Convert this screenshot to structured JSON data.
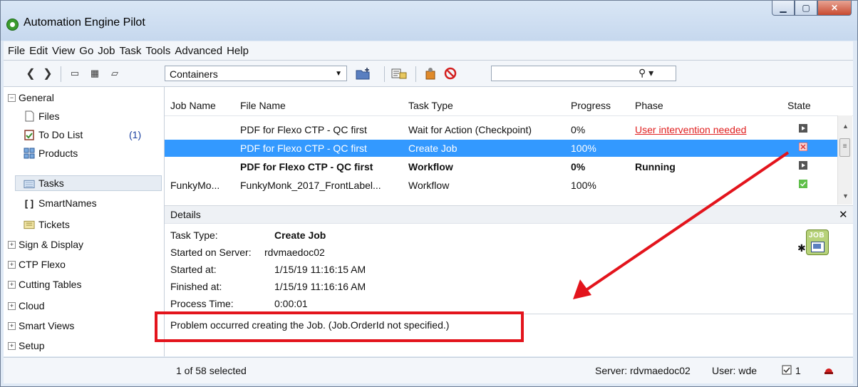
{
  "window": {
    "title": "Automation Engine Pilot"
  },
  "menu": [
    "File",
    "Edit",
    "View",
    "Go",
    "Job",
    "Task",
    "Tools",
    "Advanced",
    "Help"
  ],
  "toolbar": {
    "container_combo": "Containers",
    "search_value": ""
  },
  "sidebar": {
    "general": "General",
    "items": [
      {
        "label": "Files",
        "icon": "file-icon"
      },
      {
        "label": "To Do List",
        "icon": "todo-icon",
        "badge": "(1)"
      },
      {
        "label": "Products",
        "icon": "products-icon"
      },
      {
        "label": "Tasks",
        "icon": "tasks-icon"
      },
      {
        "label": "SmartNames",
        "icon": "smartnames-icon"
      },
      {
        "label": "Tickets",
        "icon": "tickets-icon"
      }
    ],
    "groups": [
      "Sign & Display",
      "CTP Flexo",
      "Cutting Tables",
      "Cloud",
      "Smart Views",
      "Setup"
    ]
  },
  "table": {
    "headers": [
      "Job Name",
      "File Name",
      "Task Type",
      "Progress",
      "Phase",
      "State"
    ],
    "rows": [
      {
        "job": "",
        "file": "PDF for Flexo CTP - QC first",
        "type": "Wait for Action (Checkpoint)",
        "progress": "0%",
        "phase": "User intervention needed",
        "state": "paused"
      },
      {
        "job": "",
        "file": "PDF for Flexo CTP - QC first",
        "type": "Create Job",
        "progress": "100%",
        "phase": "",
        "state": "error"
      },
      {
        "job": "",
        "file": "PDF for Flexo CTP - QC first",
        "type": "Workflow",
        "progress": "0%",
        "phase": "Running",
        "state": "paused"
      },
      {
        "job": "FunkyMo...",
        "file": "FunkyMonk_2017_FrontLabel...",
        "type": "Workflow",
        "progress": "100%",
        "phase": "",
        "state": "ok"
      }
    ]
  },
  "details": {
    "title": "Details",
    "task_type_label": "Task Type:",
    "task_type_value": "Create Job",
    "started_on_label": "Started on Server:",
    "started_on_value": "rdvmaedoc02",
    "started_at_label": "Started at:",
    "started_at_value": "1/15/19 11:16:15 AM",
    "finished_at_label": "Finished at:",
    "finished_at_value": "1/15/19 11:16:16 AM",
    "process_time_label": "Process Time:",
    "process_time_value": "0:00:01",
    "message": "Problem occurred creating the Job. (Job.OrderId not specified.)",
    "job_badge": "JOB"
  },
  "status": {
    "selection": "1 of 58 selected",
    "server": "Server: rdvmaedoc02",
    "user": "User: wde",
    "todo_count": "1"
  },
  "colors": {
    "selection": "#3399ff",
    "annotation": "#e3141c",
    "phase_link": "#e02020"
  }
}
